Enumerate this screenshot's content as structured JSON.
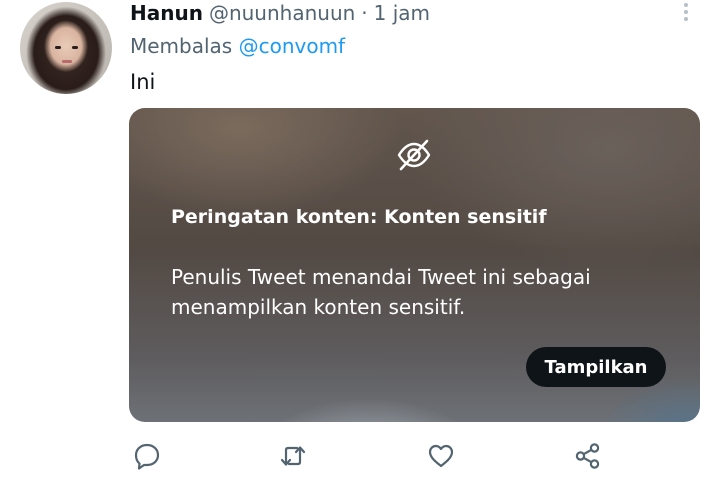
{
  "tweet": {
    "author_name": "Hanun",
    "handle": "@nuunhanuun",
    "separator": "·",
    "time": "1 jam",
    "reply_prefix": "Membalas",
    "reply_to": "@convomf",
    "text": "Ini"
  },
  "sensitive_warning": {
    "icon": "eye-off-icon",
    "title": "Peringatan konten: Konten sensitif",
    "body": "Penulis Tweet menandai Tweet ini sebagai menampilkan konten sensitif.",
    "button_label": "Tampilkan"
  },
  "actions": {
    "reply_icon": "reply-icon",
    "retweet_icon": "retweet-icon",
    "like_icon": "like-icon",
    "share_icon": "share-icon"
  },
  "colors": {
    "link": "#1d9bf0",
    "secondary_text": "#536471",
    "primary_text": "#0f1419"
  }
}
